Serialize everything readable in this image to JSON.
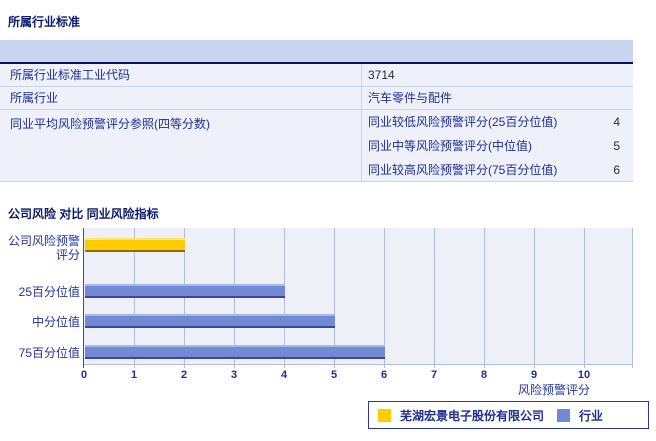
{
  "sections": {
    "industry_title": "所属行业标准",
    "compare_title": "公司风险 对比 同业风险指标"
  },
  "table": {
    "rows": [
      {
        "label": "所属行业标准工业代码",
        "value": "3714"
      },
      {
        "label": "所属行业",
        "value": "汽车零件与配件"
      },
      {
        "label": "同业平均风险预警评分参照(四等分数)"
      }
    ],
    "sub_rows": [
      {
        "label": "同业较低风险预警评分(25百分位值)",
        "value": "4"
      },
      {
        "label": "同业中等风险预警评分(中位值)",
        "value": "5"
      },
      {
        "label": "同业较高风险预警评分(75百分位值)",
        "value": "6"
      }
    ]
  },
  "chart_data": {
    "type": "bar",
    "orientation": "horizontal",
    "title": "公司风险 对比 同业风险指标",
    "categories": [
      "公司风险预警评分",
      "25百分位值",
      "中分位值",
      "75百分位值"
    ],
    "y_label_lines": [
      [
        "公司风险预警",
        "评分"
      ],
      [
        "25百分位值"
      ],
      [
        "中分位值"
      ],
      [
        "75百分位值"
      ]
    ],
    "series": [
      {
        "name": "芜湖宏景电子股份有限公司",
        "color": "#ffcc00",
        "values": [
          2,
          null,
          null,
          null
        ]
      },
      {
        "name": "行业",
        "color": "#7389d3",
        "values": [
          null,
          4,
          5,
          6
        ]
      }
    ],
    "xlabel": "风险预警评分",
    "xlim": [
      0,
      11
    ],
    "ticks": [
      0,
      1,
      2,
      3,
      4,
      5,
      6,
      7,
      8,
      9,
      10
    ],
    "grid": true,
    "legend_position": "bottom"
  },
  "colors": {
    "accent_yellow": "#ffcc00",
    "accent_blue": "#7389d3",
    "header_band": "#c7d5ee",
    "navy_text": "#1f2d96",
    "plot_bg": "#edf0f7"
  }
}
